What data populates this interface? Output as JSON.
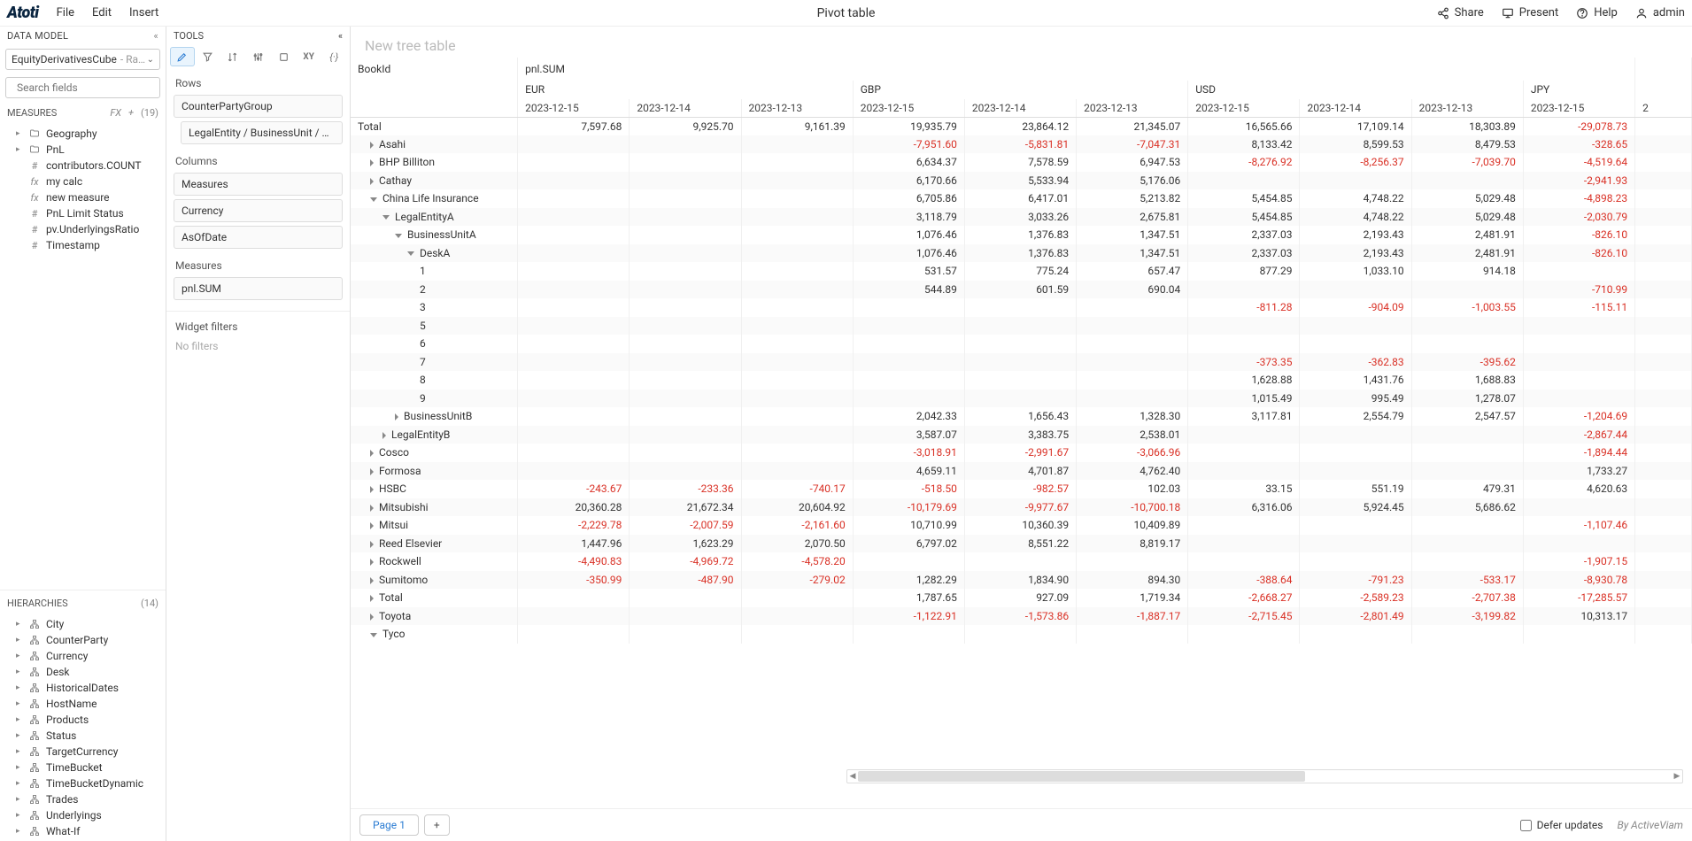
{
  "topbar": {
    "brand": "Atoti",
    "menus": [
      "File",
      "Edit",
      "Insert"
    ],
    "title": "Pivot table",
    "right": {
      "share": "Share",
      "present": "Present",
      "help": "Help",
      "user": "admin"
    }
  },
  "sidebar": {
    "dataModel": "DATA MODEL",
    "cube": {
      "name": "EquityDerivativesCube",
      "suffix": " - Ranch S..."
    },
    "searchPlaceholder": "Search fields",
    "measuresHdr": "MEASURES",
    "measuresCount": "(19)",
    "measures": [
      {
        "icon": "folder",
        "label": "Geography",
        "expandable": true
      },
      {
        "icon": "folder",
        "label": "PnL",
        "expandable": true
      },
      {
        "icon": "hash",
        "label": "contributors.COUNT"
      },
      {
        "icon": "fx",
        "label": "my calc"
      },
      {
        "icon": "fx",
        "label": "new measure"
      },
      {
        "icon": "hash",
        "label": "PnL Limit Status"
      },
      {
        "icon": "hash",
        "label": "pv.UnderlyingsRatio"
      },
      {
        "icon": "hash",
        "label": "Timestamp"
      }
    ],
    "hierarchiesHdr": "HIERARCHIES",
    "hierarchiesCount": "(14)",
    "hierarchies": [
      "City",
      "CounterParty",
      "Currency",
      "Desk",
      "HistoricalDates",
      "HostName",
      "Products",
      "Status",
      "TargetCurrency",
      "TimeBucket",
      "TimeBucketDynamic",
      "Trades",
      "Underlyings",
      "What-If"
    ]
  },
  "tools": {
    "hdr": "TOOLS",
    "rows": "Rows",
    "rowItems": [
      "CounterPartyGroup",
      "LegalEntity / BusinessUnit / Desk / B..."
    ],
    "columns": "Columns",
    "colItems": [
      "Measures",
      "Currency",
      "AsOfDate"
    ],
    "measures": "Measures",
    "measureItems": [
      "pnl.SUM"
    ],
    "filters": "Widget filters",
    "noFilters": "No filters",
    "iconNames": [
      "edit",
      "filter",
      "sort",
      "tune",
      "format",
      "xy",
      "fx"
    ]
  },
  "pivot": {
    "title": "New tree table",
    "cornerTop": "BookId",
    "cornerMeasure": "pnl.SUM",
    "currencies": [
      "EUR",
      "GBP",
      "USD",
      "JPY"
    ],
    "dates": [
      "2023-12-15",
      "2023-12-14",
      "2023-12-13"
    ],
    "lastExtra": "2",
    "rows": [
      {
        "l": "Total",
        "indent": 0,
        "v": [
          "7,597.68",
          "9,925.70",
          "9,161.39",
          "19,935.79",
          "23,864.12",
          "21,345.07",
          "16,565.66",
          "17,109.14",
          "18,303.89",
          "-29,078.73"
        ]
      },
      {
        "l": "Asahi",
        "indent": 1,
        "exp": "closed",
        "v": [
          "",
          "",
          "",
          "-7,951.60",
          "-5,831.81",
          "-7,047.31",
          "8,133.42",
          "8,599.53",
          "8,479.53",
          "-328.65"
        ]
      },
      {
        "l": "BHP Billiton",
        "indent": 1,
        "exp": "closed",
        "v": [
          "",
          "",
          "",
          "6,634.37",
          "7,578.59",
          "6,947.53",
          "-8,276.92",
          "-8,256.37",
          "-7,039.70",
          "-4,519.64"
        ]
      },
      {
        "l": "Cathay",
        "indent": 1,
        "exp": "closed",
        "v": [
          "",
          "",
          "",
          "6,170.66",
          "5,533.94",
          "5,176.06",
          "",
          "",
          "",
          "-2,941.93"
        ]
      },
      {
        "l": "China Life Insurance",
        "indent": 1,
        "exp": "open",
        "v": [
          "",
          "",
          "",
          "6,705.86",
          "6,417.01",
          "5,213.82",
          "5,454.85",
          "4,748.22",
          "5,029.48",
          "-4,898.23"
        ]
      },
      {
        "l": "LegalEntityA",
        "indent": 2,
        "exp": "open",
        "v": [
          "",
          "",
          "",
          "3,118.79",
          "3,033.26",
          "2,675.81",
          "5,454.85",
          "4,748.22",
          "5,029.48",
          "-2,030.79"
        ]
      },
      {
        "l": "BusinessUnitA",
        "indent": 3,
        "exp": "open",
        "v": [
          "",
          "",
          "",
          "1,076.46",
          "1,376.83",
          "1,347.51",
          "2,337.03",
          "2,193.43",
          "2,481.91",
          "-826.10"
        ]
      },
      {
        "l": "DeskA",
        "indent": 4,
        "exp": "open",
        "v": [
          "",
          "",
          "",
          "1,076.46",
          "1,376.83",
          "1,347.51",
          "2,337.03",
          "2,193.43",
          "2,481.91",
          "-826.10"
        ]
      },
      {
        "l": "1",
        "indent": 5,
        "v": [
          "",
          "",
          "",
          "531.57",
          "775.24",
          "657.47",
          "877.29",
          "1,033.10",
          "914.18",
          ""
        ]
      },
      {
        "l": "2",
        "indent": 5,
        "v": [
          "",
          "",
          "",
          "544.89",
          "601.59",
          "690.04",
          "",
          "",
          "",
          "-710.99"
        ]
      },
      {
        "l": "3",
        "indent": 5,
        "v": [
          "",
          "",
          "",
          "",
          "",
          "",
          "-811.28",
          "-904.09",
          "-1,003.55",
          "-115.11"
        ]
      },
      {
        "l": "5",
        "indent": 5,
        "v": [
          "",
          "",
          "",
          "",
          "",
          "",
          "",
          "",
          "",
          ""
        ]
      },
      {
        "l": "6",
        "indent": 5,
        "v": [
          "",
          "",
          "",
          "",
          "",
          "",
          "",
          "",
          "",
          ""
        ]
      },
      {
        "l": "7",
        "indent": 5,
        "v": [
          "",
          "",
          "",
          "",
          "",
          "",
          "-373.35",
          "-362.83",
          "-395.62",
          ""
        ]
      },
      {
        "l": "8",
        "indent": 5,
        "v": [
          "",
          "",
          "",
          "",
          "",
          "",
          "1,628.88",
          "1,431.76",
          "1,688.83",
          ""
        ]
      },
      {
        "l": "9",
        "indent": 5,
        "v": [
          "",
          "",
          "",
          "",
          "",
          "",
          "1,015.49",
          "995.49",
          "1,278.07",
          ""
        ]
      },
      {
        "l": "BusinessUnitB",
        "indent": 3,
        "exp": "closed",
        "v": [
          "",
          "",
          "",
          "2,042.33",
          "1,656.43",
          "1,328.30",
          "3,117.81",
          "2,554.79",
          "2,547.57",
          "-1,204.69"
        ]
      },
      {
        "l": "LegalEntityB",
        "indent": 2,
        "exp": "closed",
        "v": [
          "",
          "",
          "",
          "3,587.07",
          "3,383.75",
          "2,538.01",
          "",
          "",
          "",
          "-2,867.44"
        ]
      },
      {
        "l": "Cosco",
        "indent": 1,
        "exp": "closed",
        "v": [
          "",
          "",
          "",
          "-3,018.91",
          "-2,991.67",
          "-3,066.96",
          "",
          "",
          "",
          "-1,894.44"
        ]
      },
      {
        "l": "Formosa",
        "indent": 1,
        "exp": "closed",
        "v": [
          "",
          "",
          "",
          "4,659.11",
          "4,701.87",
          "4,762.40",
          "",
          "",
          "",
          "1,733.27"
        ]
      },
      {
        "l": "HSBC",
        "indent": 1,
        "exp": "closed",
        "v": [
          "-243.67",
          "-233.36",
          "-740.17",
          "-518.50",
          "-982.57",
          "102.03",
          "33.15",
          "551.19",
          "479.31",
          "4,620.63"
        ]
      },
      {
        "l": "Mitsubishi",
        "indent": 1,
        "exp": "closed",
        "v": [
          "20,360.28",
          "21,672.34",
          "20,604.92",
          "-10,179.69",
          "-9,977.67",
          "-10,700.18",
          "6,316.06",
          "5,924.45",
          "5,686.62",
          ""
        ]
      },
      {
        "l": "Mitsui",
        "indent": 1,
        "exp": "closed",
        "v": [
          "-2,229.78",
          "-2,007.59",
          "-2,161.60",
          "10,710.99",
          "10,360.39",
          "10,409.89",
          "",
          "",
          "",
          "-1,107.46"
        ]
      },
      {
        "l": "Reed Elsevier",
        "indent": 1,
        "exp": "closed",
        "v": [
          "1,447.96",
          "1,623.29",
          "2,070.50",
          "6,797.02",
          "8,551.22",
          "8,819.17",
          "",
          "",
          "",
          ""
        ]
      },
      {
        "l": "Rockwell",
        "indent": 1,
        "exp": "closed",
        "v": [
          "-4,490.83",
          "-4,969.72",
          "-4,578.20",
          "",
          "",
          "",
          "",
          "",
          "",
          "-1,907.15"
        ]
      },
      {
        "l": "Sumitomo",
        "indent": 1,
        "exp": "closed",
        "v": [
          "-350.99",
          "-487.90",
          "-279.02",
          "1,282.29",
          "1,834.90",
          "894.30",
          "-388.64",
          "-791.23",
          "-533.17",
          "-8,930.78"
        ]
      },
      {
        "l": "Total",
        "indent": 1,
        "exp": "closed",
        "v": [
          "",
          "",
          "",
          "1,787.65",
          "927.09",
          "1,719.34",
          "-2,668.27",
          "-2,589.23",
          "-2,707.38",
          "-17,285.57"
        ]
      },
      {
        "l": "Toyota",
        "indent": 1,
        "exp": "closed",
        "v": [
          "",
          "",
          "",
          "-1,122.91",
          "-1,573.86",
          "-1,887.17",
          "-2,715.45",
          "-2,801.49",
          "-3,199.82",
          "10,313.17"
        ]
      },
      {
        "l": "Tyco",
        "indent": 1,
        "exp": "open",
        "v": [
          "",
          "",
          "",
          "",
          "",
          "",
          "",
          "",
          "",
          ""
        ]
      }
    ]
  },
  "footer": {
    "page": "Page 1",
    "defer": "Defer updates",
    "byline": "By ActiveViam"
  }
}
